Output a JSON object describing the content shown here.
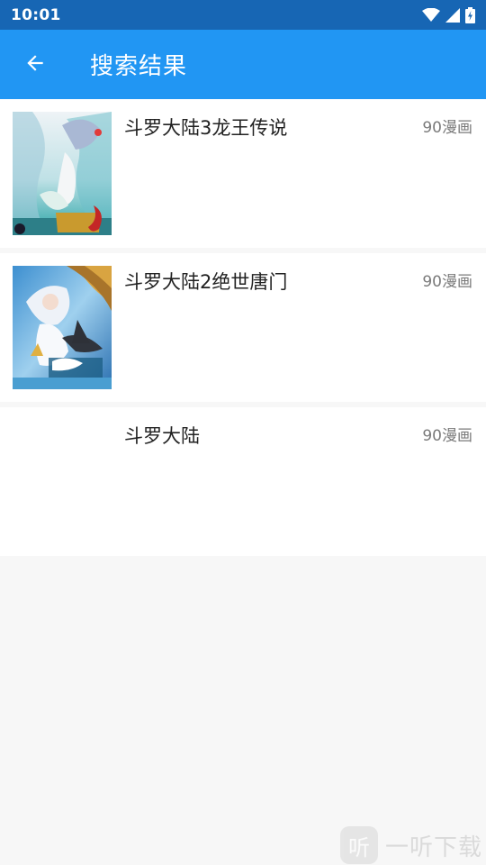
{
  "status_bar": {
    "time": "10:01",
    "icons": [
      "wifi-icon",
      "signal-icon",
      "battery-charging-icon"
    ]
  },
  "app_bar": {
    "title": "搜索结果",
    "back_icon": "arrow-left-icon"
  },
  "results": [
    {
      "title": "斗罗大陆3龙王传说",
      "source": "90漫画",
      "has_cover": true
    },
    {
      "title": "斗罗大陆2绝世唐门",
      "source": "90漫画",
      "has_cover": true
    },
    {
      "title": "斗罗大陆",
      "source": "90漫画",
      "has_cover": false
    }
  ],
  "watermark": {
    "text": "一听下载",
    "logo_glyph": "听"
  },
  "colors": {
    "status_bar": "#1766b4",
    "app_bar": "#2196f3",
    "background": "#f7f7f7",
    "card": "#ffffff"
  }
}
